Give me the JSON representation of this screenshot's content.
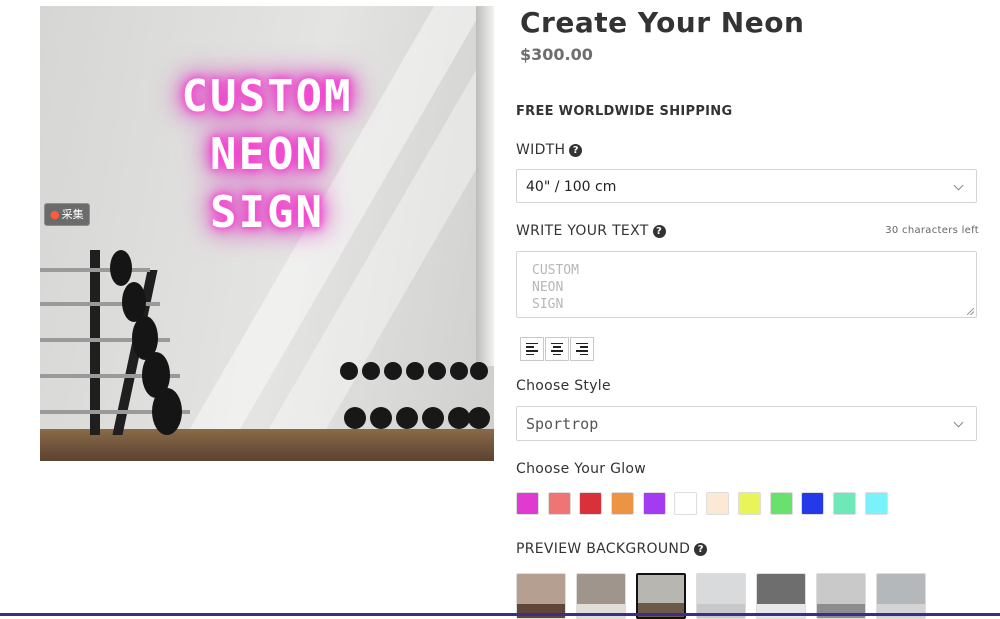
{
  "product": {
    "title": "Create Your Neon",
    "price": "$300.00",
    "shipping": "FREE WORLDWIDE SHIPPING"
  },
  "preview": {
    "neon_lines": [
      "CUSTOM",
      "NEON",
      "SIGN"
    ],
    "neon_glow_color": "#ff2bd0",
    "collect_badge": "采集",
    "collect_icon": "dot-icon"
  },
  "width_field": {
    "label": "WIDTH",
    "help_icon": "question-icon",
    "value": "40\" / 100 cm"
  },
  "text_field": {
    "label": "WRITE YOUR TEXT",
    "help_icon": "question-icon",
    "chars_left": "30 characters left",
    "placeholder": "CUSTOM\nNEON\nSIGN"
  },
  "alignment": {
    "buttons": [
      "align-left",
      "align-center",
      "align-right"
    ]
  },
  "style_field": {
    "label": "Choose Style",
    "value": "Sportrop"
  },
  "glow_field": {
    "label": "Choose Your Glow",
    "colors": [
      "#e03ad0",
      "#ef7474",
      "#d8313a",
      "#ec9443",
      "#a33cf0",
      "#ffffff",
      "#fbe9d6",
      "#e9f45a",
      "#69e26d",
      "#2439e8",
      "#6fe8b9",
      "#79f2fb"
    ]
  },
  "background_field": {
    "label": "PREVIEW BACKGROUND",
    "help_icon": "question-icon",
    "selected_index": 2,
    "thumbnails": [
      {
        "wall": "#b59f90",
        "floor": "#5f4638"
      },
      {
        "wall": "#9f958d",
        "floor": "#e1ded9"
      },
      {
        "wall": "#b8b6b1",
        "floor": "#6c5a48"
      },
      {
        "wall": "#d9dadc",
        "floor": "#c8c8c8"
      },
      {
        "wall": "#6e6e6e",
        "floor": "#e8e8e8"
      },
      {
        "wall": "#c9c9c9",
        "floor": "#8d8d8d"
      },
      {
        "wall": "#b5b8bb",
        "floor": "#d4d4d4"
      }
    ]
  },
  "accent_color": "#3a2e8a"
}
